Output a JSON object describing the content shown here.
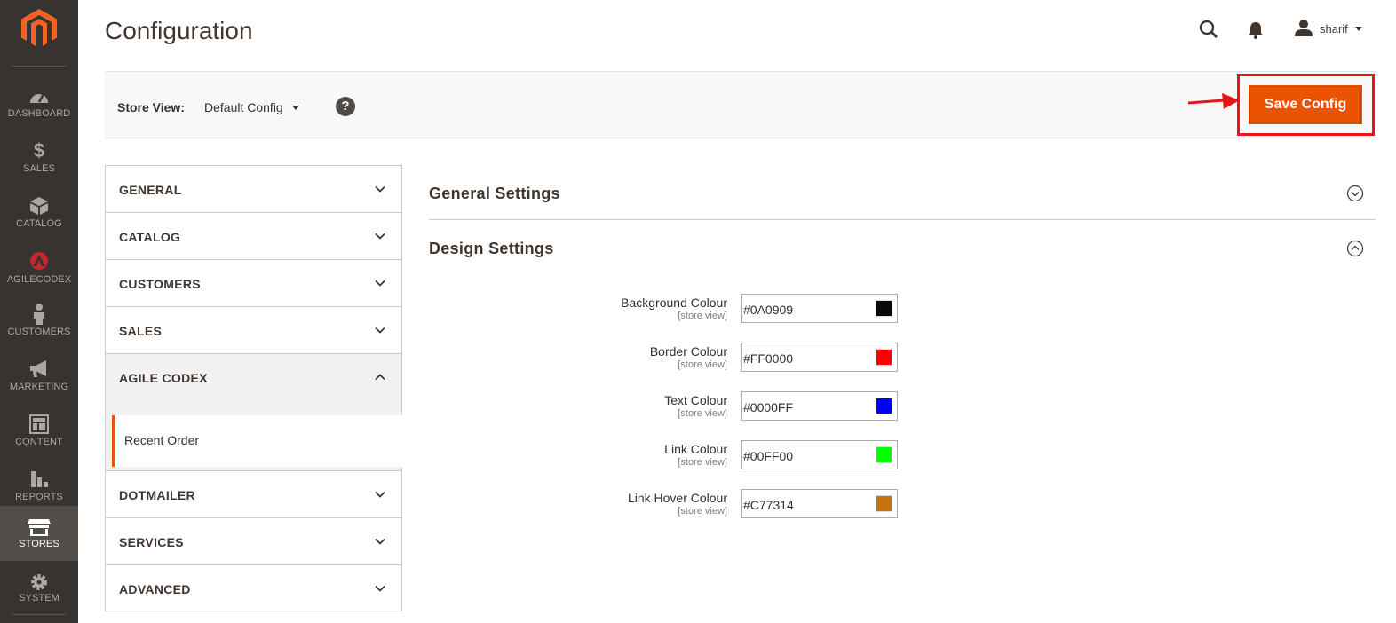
{
  "nav": {
    "items": [
      {
        "label": "DASHBOARD",
        "icon": "dashboard-icon"
      },
      {
        "label": "SALES",
        "icon": "dollar-icon"
      },
      {
        "label": "CATALOG",
        "icon": "cube-icon"
      },
      {
        "label": "AGILECODEX",
        "icon": "agilecodex-icon"
      },
      {
        "label": "CUSTOMERS",
        "icon": "person-icon"
      },
      {
        "label": "MARKETING",
        "icon": "megaphone-icon"
      },
      {
        "label": "CONTENT",
        "icon": "layout-icon"
      },
      {
        "label": "REPORTS",
        "icon": "bar-chart-icon"
      },
      {
        "label": "STORES",
        "icon": "storefront-icon",
        "active": true
      },
      {
        "label": "SYSTEM",
        "icon": "gear-icon"
      }
    ]
  },
  "header": {
    "title": "Configuration",
    "user": "sharif"
  },
  "store_bar": {
    "label": "Store View:",
    "value": "Default Config",
    "help": "?",
    "save_label": "Save Config"
  },
  "tabs": [
    {
      "label": "GENERAL"
    },
    {
      "label": "CATALOG"
    },
    {
      "label": "CUSTOMERS"
    },
    {
      "label": "SALES"
    },
    {
      "label": "AGILE CODEX",
      "open": true,
      "sub": "Recent Order"
    },
    {
      "label": "DOTMAILER"
    },
    {
      "label": "SERVICES"
    },
    {
      "label": "ADVANCED"
    }
  ],
  "sections": {
    "general": {
      "title": "General Settings"
    },
    "design": {
      "title": "Design Settings"
    }
  },
  "fields": [
    {
      "label": "Background Colour",
      "scope": "[store view]",
      "value": "#0A0909",
      "color": "#0A0909"
    },
    {
      "label": "Border Colour",
      "scope": "[store view]",
      "value": "#FF0000",
      "color": "#FF0000"
    },
    {
      "label": "Text Colour",
      "scope": "[store view]",
      "value": "#0000FF",
      "color": "#0000FF"
    },
    {
      "label": "Link Colour",
      "scope": "[store view]",
      "value": "#00FF00",
      "color": "#00FF00"
    },
    {
      "label": "Link Hover Colour",
      "scope": "[store view]",
      "value": "#C77314",
      "color": "#C77314"
    }
  ],
  "colors": {
    "accent": "#EB5202",
    "highlight": "#E31717",
    "nav_bg": "#373330"
  }
}
